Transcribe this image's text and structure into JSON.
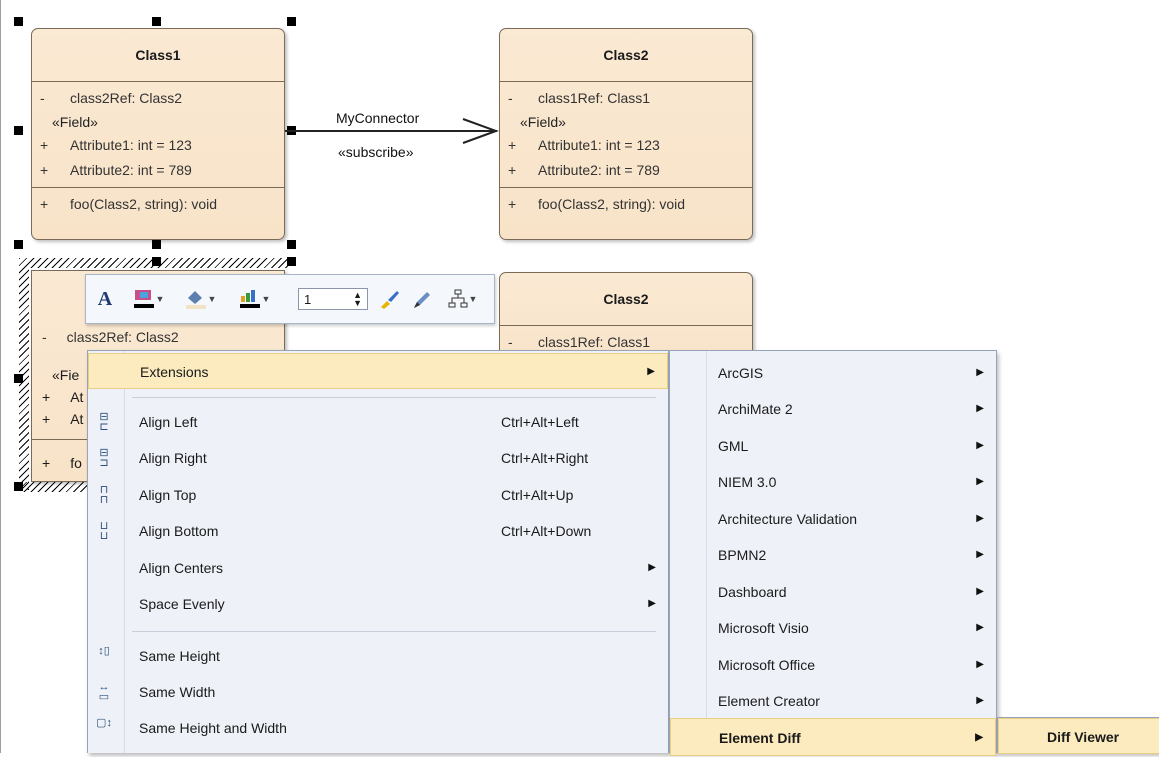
{
  "diagram": {
    "class1": {
      "title": "Class1",
      "attr_ref": {
        "vis": "-",
        "text": "class2Ref: Class2"
      },
      "stereotype": "«Field»",
      "attrs": [
        {
          "vis": "+",
          "text": "Attribute1: int = 123"
        },
        {
          "vis": "+",
          "text": "Attribute2: int = 789"
        }
      ],
      "ops": [
        {
          "vis": "+",
          "text": "foo(Class2, string): void"
        }
      ]
    },
    "class2": {
      "title": "Class2",
      "attr_ref": {
        "vis": "-",
        "text": "class1Ref: Class1"
      },
      "stereotype": "«Field»",
      "attrs": [
        {
          "vis": "+",
          "text": "Attribute1: int = 123"
        },
        {
          "vis": "+",
          "text": "Attribute2: int = 789"
        }
      ],
      "ops": [
        {
          "vis": "+",
          "text": "foo(Class2, string): void"
        }
      ]
    },
    "class3": {
      "attr_ref": {
        "vis": "-",
        "text": "class2Ref: Class2"
      },
      "stereo_partial": "«Fie",
      "attrs": [
        {
          "vis": "+",
          "text": "At"
        },
        {
          "vis": "+",
          "text": "At"
        }
      ],
      "ops": [
        {
          "vis": "+",
          "text": "fo"
        }
      ]
    },
    "class4": {
      "title": "Class2",
      "attr_ref": {
        "vis": "-",
        "text": "class1Ref: Class1"
      }
    },
    "connector": {
      "name": "MyConnector",
      "stereotype": "«subscribe»"
    }
  },
  "toolbar": {
    "font_glyph": "A",
    "line_width": "1",
    "icons": [
      "font-icon",
      "font-color-icon",
      "fill-color-icon",
      "line-color-icon",
      "line-width-spinner",
      "brush-icon",
      "pen-icon",
      "layout-icon"
    ]
  },
  "context_menu": {
    "items": [
      {
        "label": "Extensions",
        "shortcut": "",
        "submenu": true
      },
      {
        "label": "Align Left",
        "shortcut": "Ctrl+Alt+Left",
        "submenu": false
      },
      {
        "label": "Align Right",
        "shortcut": "Ctrl+Alt+Right",
        "submenu": false
      },
      {
        "label": "Align Top",
        "shortcut": "Ctrl+Alt+Up",
        "submenu": false
      },
      {
        "label": "Align Bottom",
        "shortcut": "Ctrl+Alt+Down",
        "submenu": false
      },
      {
        "label": "Align Centers",
        "shortcut": "",
        "submenu": true
      },
      {
        "label": "Space Evenly",
        "shortcut": "",
        "submenu": true
      },
      {
        "label": "Same Height",
        "shortcut": "",
        "submenu": false
      },
      {
        "label": "Same Width",
        "shortcut": "",
        "submenu": false
      },
      {
        "label": "Same Height and Width",
        "shortcut": "",
        "submenu": false
      }
    ]
  },
  "extensions_menu": {
    "items": [
      {
        "label": "ArcGIS"
      },
      {
        "label": "ArchiMate 2"
      },
      {
        "label": "GML"
      },
      {
        "label": "NIEM 3.0"
      },
      {
        "label": "Architecture Validation"
      },
      {
        "label": "BPMN2"
      },
      {
        "label": "Dashboard"
      },
      {
        "label": "Microsoft Visio"
      },
      {
        "label": "Microsoft Office"
      },
      {
        "label": "Element Creator"
      },
      {
        "label": "Element Diff"
      }
    ]
  },
  "element_diff_menu": {
    "items": [
      {
        "label": "Diff Viewer"
      }
    ]
  },
  "colors": {
    "class_fill": "#f8e3c8",
    "menu_bg": "#eef2f8",
    "menu_highlight": "#fcebbf"
  }
}
